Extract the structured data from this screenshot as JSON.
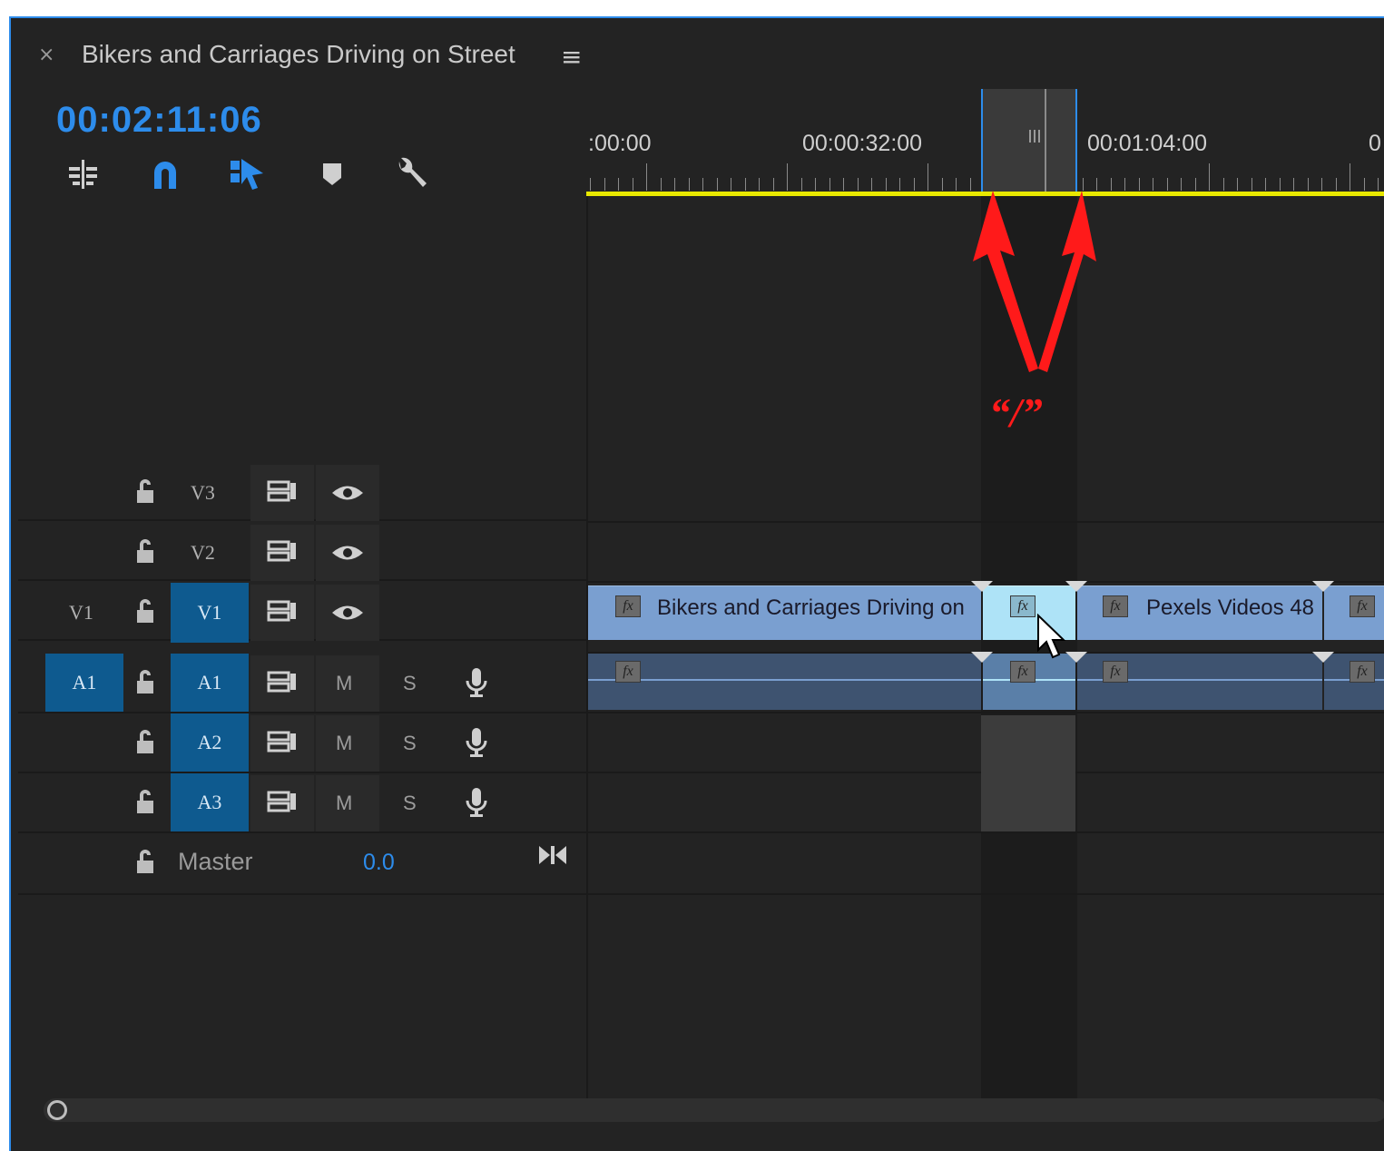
{
  "panel": {
    "close_glyph": "×",
    "sequence_title": "Bikers and Carriages Driving on Street",
    "menu_glyph": "≡",
    "timecode": "00:02:11:06"
  },
  "toolbar": {
    "tools": [
      "insert-edit-icon",
      "snap-magnet-icon",
      "linked-selection-icon",
      "add-marker-icon",
      "wrench-settings-icon"
    ]
  },
  "ruler": {
    "labels": [
      ":00:00",
      "00:00:32:00",
      "00:01:04:00",
      "0"
    ]
  },
  "annotation": {
    "key_label": "“/”",
    "color": "#ff1a1a"
  },
  "tracks": {
    "video": [
      {
        "source": "",
        "name": "V3"
      },
      {
        "source": "",
        "name": "V2"
      },
      {
        "source": "V1",
        "name": "V1"
      }
    ],
    "audio": [
      {
        "source": "A1",
        "name": "A1",
        "m": "M",
        "s": "S"
      },
      {
        "source": "",
        "name": "A2",
        "m": "M",
        "s": "S"
      },
      {
        "source": "",
        "name": "A3",
        "m": "M",
        "s": "S"
      }
    ],
    "master": {
      "label": "Master",
      "value": "0.0"
    }
  },
  "clips": {
    "video": [
      {
        "label": "Bikers and Carriages Driving on"
      },
      {
        "label": ""
      },
      {
        "label": "Pexels Videos 48"
      },
      {
        "label": ""
      }
    ],
    "fx_label": "fx"
  },
  "colors": {
    "accent": "#2d8ceb",
    "playhead_bar": "#e8e800",
    "video_clip": "#7a9fd0",
    "selected_clip": "#aee3f7",
    "audio_clip": "#3e5370"
  }
}
